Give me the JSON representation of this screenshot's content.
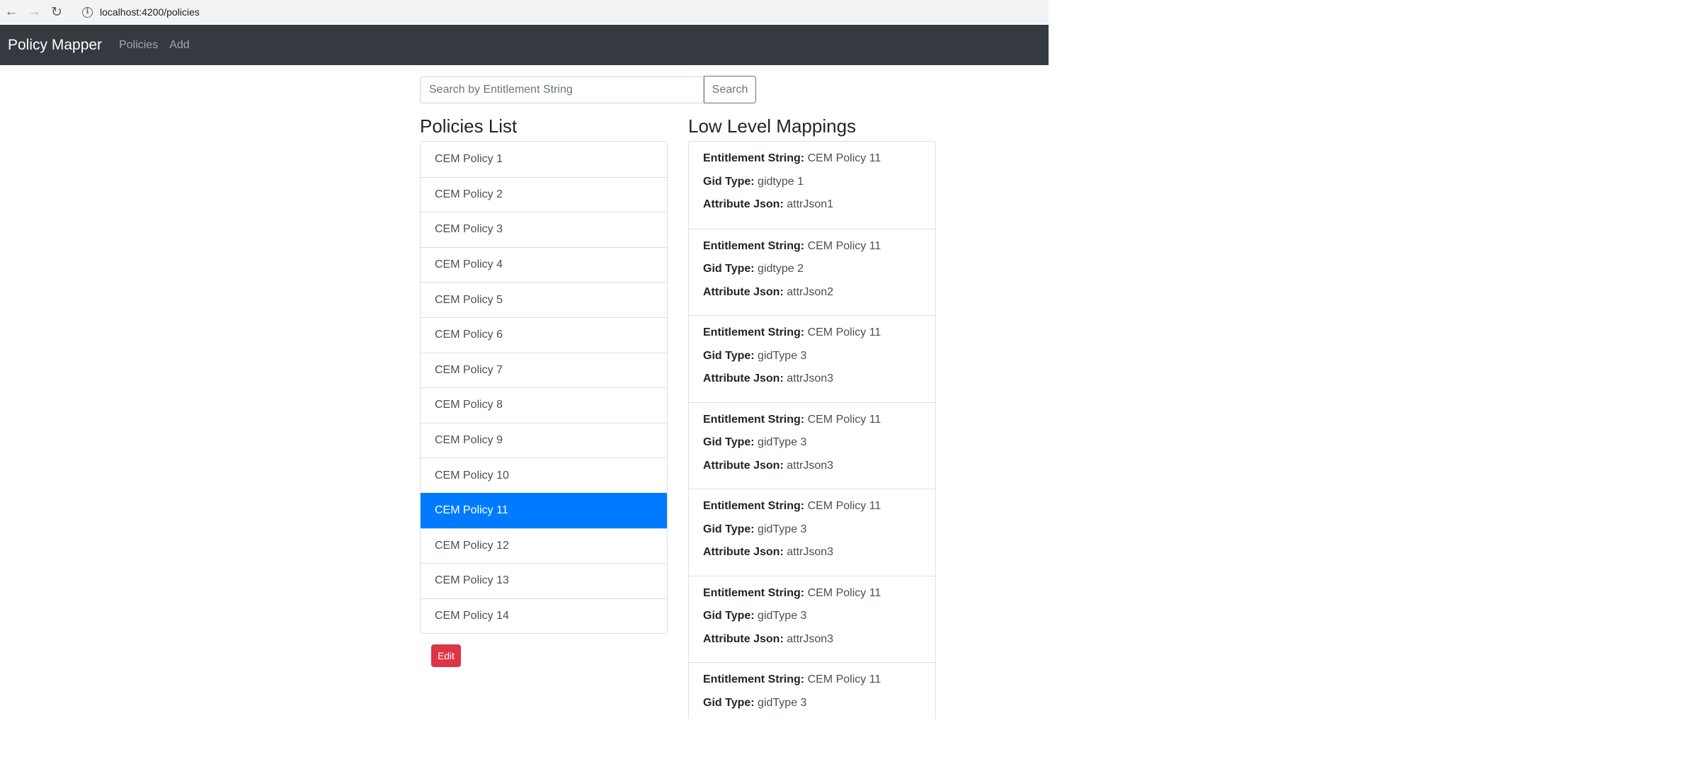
{
  "browser": {
    "url": "localhost:4200/policies"
  },
  "navbar": {
    "brand": "Policy Mapper",
    "links": [
      "Policies",
      "Add"
    ]
  },
  "search": {
    "placeholder": "Search by Entitlement String",
    "button_label": "Search"
  },
  "policies": {
    "heading": "Policies List",
    "active_index": 10,
    "items": [
      "CEM Policy 1",
      "CEM Policy 2",
      "CEM Policy 3",
      "CEM Policy 4",
      "CEM Policy 5",
      "CEM Policy 6",
      "CEM Policy 7",
      "CEM Policy 8",
      "CEM Policy 9",
      "CEM Policy 10",
      "CEM Policy 11",
      "CEM Policy 12",
      "CEM Policy 13",
      "CEM Policy 14"
    ],
    "edit_label": "Edit"
  },
  "mappings": {
    "heading": "Low Level Mappings",
    "labels": {
      "entitlement": "Entitlement String:",
      "gid": "Gid Type:",
      "attr": "Attribute Json:"
    },
    "items": [
      {
        "entitlement": "CEM Policy 11",
        "gid": "gidtype 1",
        "attr": "attrJson1"
      },
      {
        "entitlement": "CEM Policy 11",
        "gid": "gidtype 2",
        "attr": "attrJson2"
      },
      {
        "entitlement": "CEM Policy 11",
        "gid": "gidType 3",
        "attr": "attrJson3"
      },
      {
        "entitlement": "CEM Policy 11",
        "gid": "gidType 3",
        "attr": "attrJson3"
      },
      {
        "entitlement": "CEM Policy 11",
        "gid": "gidType 3",
        "attr": "attrJson3"
      },
      {
        "entitlement": "CEM Policy 11",
        "gid": "gidType 3",
        "attr": "attrJson3"
      },
      {
        "entitlement": "CEM Policy 11",
        "gid": "gidType 3",
        "attr": null
      }
    ]
  },
  "colors": {
    "navbar_bg": "#343a40",
    "active_item": "#007bff",
    "danger": "#dc3545"
  }
}
